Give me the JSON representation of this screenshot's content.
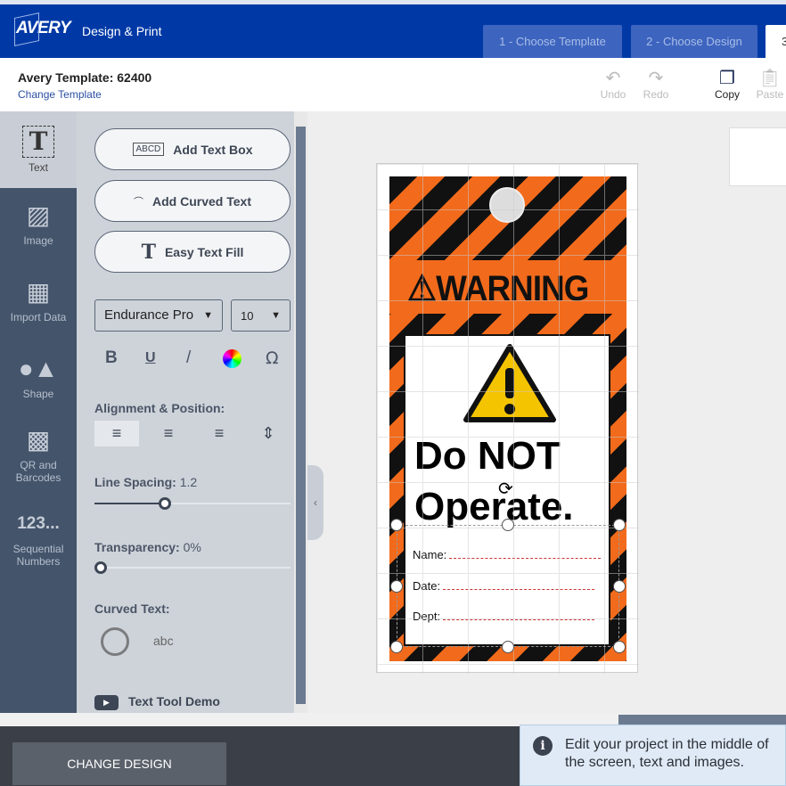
{
  "header": {
    "logo": "AVERY",
    "brand": "Design & Print",
    "tabs": [
      {
        "label": "1 - Choose Template"
      },
      {
        "label": "2 - Choose Design"
      },
      {
        "label": "3"
      }
    ]
  },
  "subheader": {
    "template": "Avery Template: 62400",
    "change_template": "Change Template",
    "tools": [
      {
        "label": "Undo",
        "icon": "undo-icon"
      },
      {
        "label": "Redo",
        "icon": "redo-icon"
      },
      {
        "label": "Copy",
        "icon": "copy-icon"
      },
      {
        "label": "Paste",
        "icon": "paste-icon"
      }
    ]
  },
  "rail": {
    "items": [
      {
        "label": "Text",
        "icon": "text-icon"
      },
      {
        "label": "Image",
        "icon": "image-icon"
      },
      {
        "label": "Import Data",
        "icon": "grid-icon"
      },
      {
        "label": "Shape",
        "icon": "shape-icon"
      },
      {
        "label": "QR and Barcodes",
        "icon": "qr-icon"
      },
      {
        "label": "Sequential Numbers",
        "icon": "123..."
      }
    ]
  },
  "panel": {
    "add_text_box": "Add Text Box",
    "add_text_box_icon": "ABCD",
    "add_curved_text": "Add Curved Text",
    "easy_text_fill": "Easy Text Fill",
    "font": "Endurance Pro",
    "size": "10",
    "alignment_label": "Alignment & Position:",
    "line_spacing_label": "Line Spacing:",
    "line_spacing": "1.2",
    "transparency_label": "Transparency:",
    "transparency": "0%",
    "curved_text_label": "Curved Text:",
    "curved_icon_text": "abc",
    "demo": "Text Tool Demo"
  },
  "canvas": {
    "warning": "WARNING",
    "main_text_1": "Do NOT",
    "main_text_2": "Operate.",
    "fields": [
      "Name:",
      "Date:",
      "Dept:"
    ]
  },
  "footer": {
    "change_design": "CHANGE DESIGN",
    "toast": "Edit your project in the middle of the screen, text and images."
  },
  "colors": {
    "header": "#0039a6",
    "rail": "#44546b",
    "panel": "#ced3da",
    "stripe_orange": "#f26a1b",
    "warning_yellow": "#f5c400"
  }
}
